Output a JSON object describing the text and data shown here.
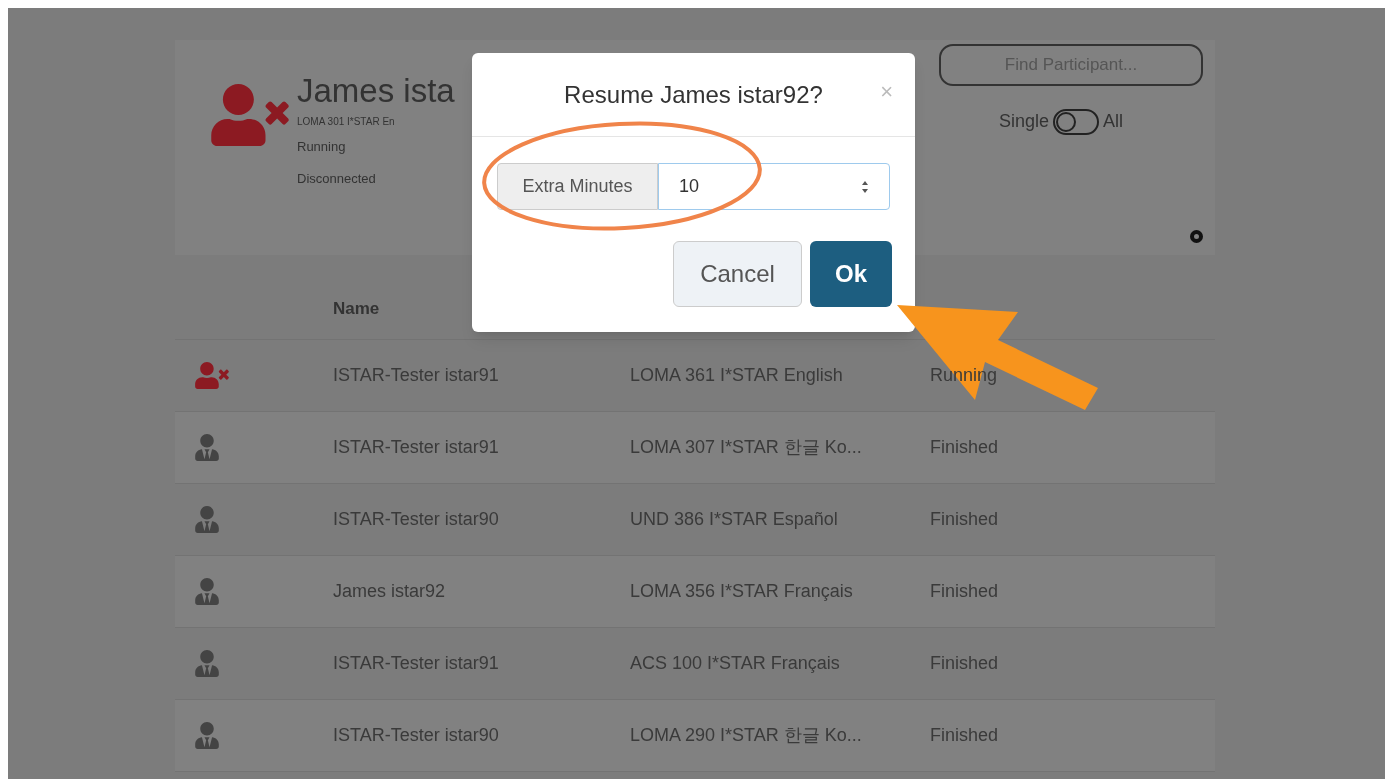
{
  "participant": {
    "kind": "disconnected",
    "name": "James ista",
    "course": "LOMA 301 I*STAR En",
    "status": "Running",
    "connection": "Disconnected"
  },
  "search": {
    "placeholder": "Find Participant..."
  },
  "scope_toggle": {
    "left_label": "Single",
    "right_label": "All",
    "all_selected": false
  },
  "table": {
    "columns": [
      "Name"
    ],
    "rows": [
      {
        "kind": "disconnected",
        "name": "ISTAR-Tester istar91",
        "course": "LOMA 361 I*STAR English",
        "status": "Running"
      },
      {
        "kind": "normal",
        "name": "ISTAR-Tester istar91",
        "course": "LOMA 307 I*STAR 한글 Ko...",
        "status": "Finished"
      },
      {
        "kind": "normal",
        "name": "ISTAR-Tester istar90",
        "course": "UND 386 I*STAR Español",
        "status": "Finished"
      },
      {
        "kind": "normal",
        "name": "James istar92",
        "course": "LOMA 356 I*STAR Français",
        "status": "Finished"
      },
      {
        "kind": "normal",
        "name": "ISTAR-Tester istar91",
        "course": "ACS 100 I*STAR Français",
        "status": "Finished"
      },
      {
        "kind": "normal",
        "name": "ISTAR-Tester istar90",
        "course": "LOMA 290 I*STAR 한글 Ko...",
        "status": "Finished"
      }
    ]
  },
  "dialog": {
    "title": "Resume James istar92?",
    "close": "×",
    "field_label": "Extra Minutes",
    "field_value": "10",
    "buttons": [
      {
        "kind": "secondary",
        "label": "Cancel"
      },
      {
        "kind": "primary",
        "label": "Ok"
      }
    ]
  }
}
